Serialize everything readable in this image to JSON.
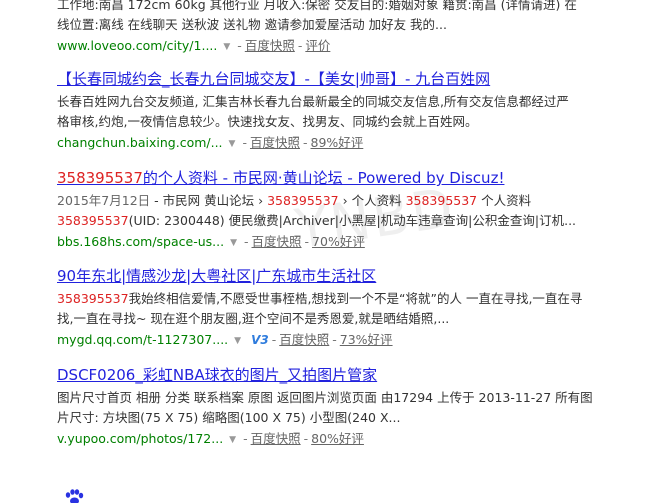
{
  "results": [
    {
      "title": "",
      "abstract": [
        "工作地:南昌 172cm 60kg 其他行业 月收入:保密 交友目的:婚姻对象 籍贯:南昌 (详情请进) 在",
        "线位置:离线 在线聊天 送秋波 送礼物 邀请参加爱屋活动 加好友 我的..."
      ],
      "url": "www.loveoo.com/city/1....",
      "cache": "百度快照",
      "rating": "评价"
    },
    {
      "title": "【长春同城约会_长春九台同城交友】-【美女|帅哥】- 九台百姓网",
      "abstract": [
        "长春百姓网九台交友频道, 汇集吉林长春九台最新最全的同城交友信息,所有交友信息都经过严",
        "格审核,约炮,一夜情信息较少。快速找女友、找男友、同城约会就上百姓网。"
      ],
      "url": "changchun.baixing.com/...",
      "cache": "百度快照",
      "rating": "89%好评"
    },
    {
      "title_hl": "358395537",
      "title_rest": "的个人资料 - 市民网·黄山论坛 - Powered by Discuz!",
      "date": "2015年7月12日",
      "abstract_line1_a": " - 市民网 黄山论坛 › ",
      "abstract_line1_hl": "358395537",
      "abstract_line1_b": " › 个人资料 ",
      "abstract_line1_hl2": "358395537",
      "abstract_line1_c": " 个人资料",
      "abstract_line2_hl": "358395537",
      "abstract_line2_rest": "(UID: 2300448) 便民缴费|Archiver|小黑屋|机动车违章查询|公积金查询|订机...",
      "url": "bbs.168hs.com/space-us...",
      "cache": "百度快照",
      "rating": "70%好评"
    },
    {
      "title": "90年东北|情感沙龙|大粤社区|广东城市生活社区",
      "abstract_line1_hl": "358395537",
      "abstract_line1_rest": "我始终相信爱情,不愿受世事桎梏,想找到一个不是“将就”的人 一直在寻找,一直在寻",
      "abstract_line2": "找,一直在寻找~ 现在逛个朋友圈,逛个空间不是秀恩爱,就是晒结婚照,...",
      "url": "mygd.qq.com/t-1127307....",
      "cache": "百度快照",
      "rating": "73%好评",
      "badge": "V3"
    },
    {
      "title": "DSCF0206_彩虹NBA球衣的图片_又拍图片管家",
      "abstract": [
        "图片尺寸首页 相册 分类 联系档案 原图 返回图片浏览页面 由17294 上传于 2013-11-27 所有图",
        "片尺寸: 方块图(75 X 75) 缩略图(100 X 75) 小型图(240 X..."
      ],
      "url": "v.yupoo.com/photos/172...",
      "cache": "百度快照",
      "rating": "80%好评"
    }
  ],
  "separator": "-",
  "watermark": "YNBD"
}
